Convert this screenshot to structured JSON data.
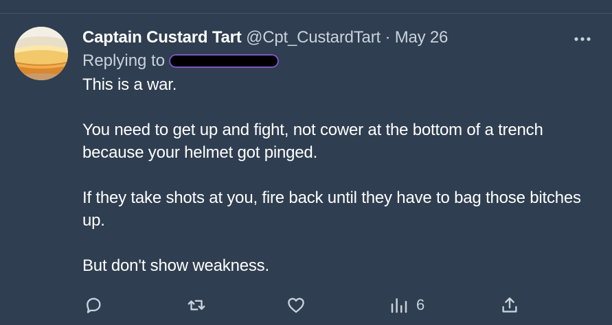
{
  "tweet": {
    "display_name": "Captain Custard Tart",
    "handle": "@Cpt_CustardTart",
    "separator": "·",
    "date": "May 26",
    "replying_to_label": "Replying to",
    "paragraphs": [
      "This is a war.",
      "You need to get up and fight, not cower at the bottom of a trench because your helmet got pinged.",
      "If they take shots at you, fire back until they have to bag those bitches up.",
      "But don't show weakness."
    ]
  },
  "actions": {
    "views_count": "6"
  },
  "icons": {
    "more": "more-horizontal-icon",
    "reply": "reply-bubble-icon",
    "retweet": "retweet-icon",
    "like": "heart-icon",
    "views": "analytics-bars-icon",
    "share": "share-upload-icon"
  },
  "colors": {
    "background": "#2f3e50",
    "text": "#ffffff",
    "secondary_text": "#c9d2dc"
  }
}
